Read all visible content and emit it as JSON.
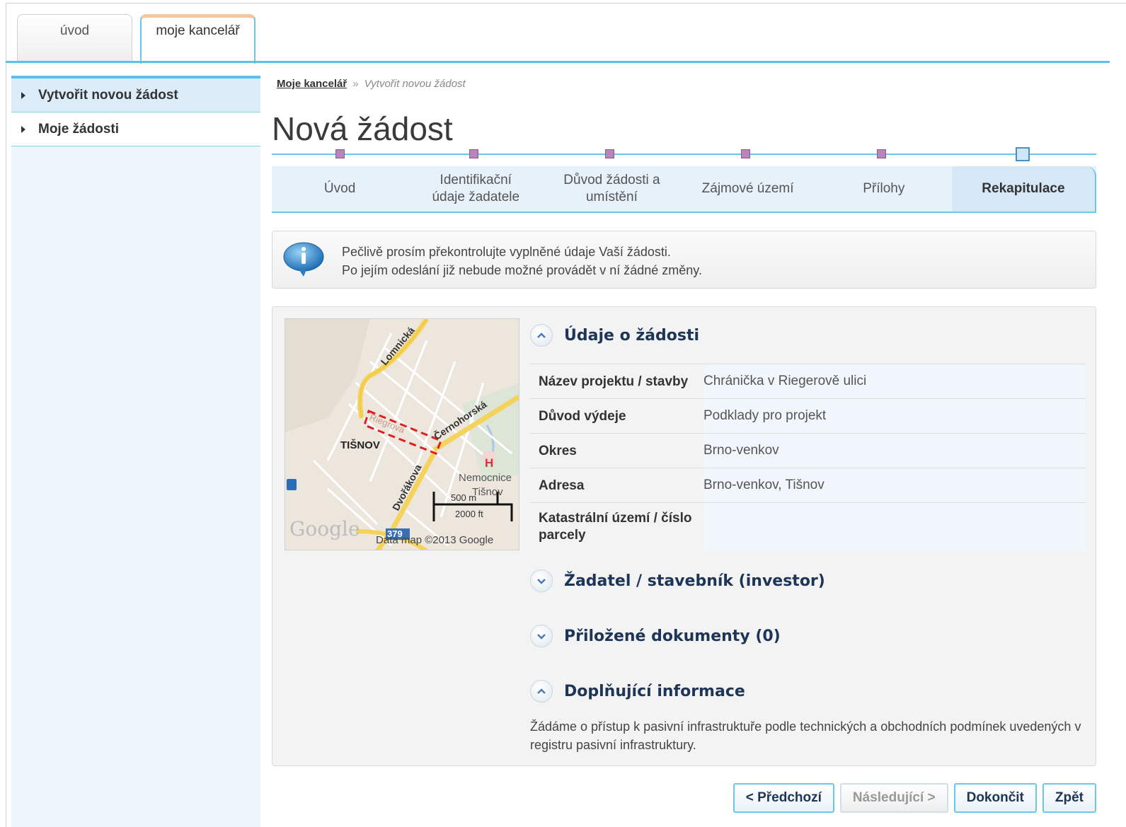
{
  "top_tabs": [
    {
      "label": "úvod"
    },
    {
      "label": "moje kancelář"
    }
  ],
  "sidebar": {
    "items": [
      {
        "label": "Vytvořit novou žádost"
      },
      {
        "label": "Moje žádosti"
      }
    ]
  },
  "breadcrumb": {
    "root": "Moje kancelář",
    "separator": "»",
    "current": "Vytvořit novou žádost"
  },
  "page_title": "Nová žádost",
  "steps": [
    {
      "line1": "Úvod",
      "line2": ""
    },
    {
      "line1": "Identifikační",
      "line2": "údaje žadatele"
    },
    {
      "line1": "Důvod žádosti a",
      "line2": "umístění"
    },
    {
      "line1": "Zájmové území",
      "line2": ""
    },
    {
      "line1": "Přílohy",
      "line2": ""
    },
    {
      "line1": "Rekapitulace",
      "line2": ""
    }
  ],
  "info": {
    "line1": "Pečlivě prosím překontrolujte vyplněné údaje Vaší žádosti.",
    "line2": "Po jejím odeslání již nebude možné provádět v ní žádné změny."
  },
  "map": {
    "streets": [
      "Lomnická",
      "Riegrova",
      "Černohorská",
      "Dvořákova"
    ],
    "town": "TIŠNOV",
    "hospital_marker": "H",
    "hospital_label_1": "Nemocnice",
    "hospital_label_2": "Tišnov",
    "scale_m": "500 m",
    "scale_ft": "2000 ft",
    "road_number": "379",
    "logo": "Google",
    "copyright": "Data map ©2013 Google"
  },
  "sections": {
    "request": {
      "title": "Údaje o žádosti",
      "rows": [
        {
          "key": "Název projektu / stavby",
          "value": "Chránička v Riegerově ulici"
        },
        {
          "key": "Důvod výdeje",
          "value": "Podklady pro projekt"
        },
        {
          "key": "Okres",
          "value": "Brno-venkov"
        },
        {
          "key": "Adresa",
          "value": "Brno-venkov, Tišnov"
        },
        {
          "key": "Katastrální území / číslo parcely",
          "value": ""
        }
      ]
    },
    "applicant": {
      "title": "Žadatel / stavebník (investor)"
    },
    "attachments": {
      "title": "Přiložené dokumenty (0)"
    },
    "extra": {
      "title": "Doplňující informace",
      "text": "Žádáme o přístup k pasivní infrastruktuře podle technických a obchodních podmínek uvedených v registru pasivní infrastruktury."
    }
  },
  "buttons": {
    "prev": "< Předchozí",
    "next": "Následující >",
    "finish": "Dokončit",
    "back": "Zpět"
  }
}
